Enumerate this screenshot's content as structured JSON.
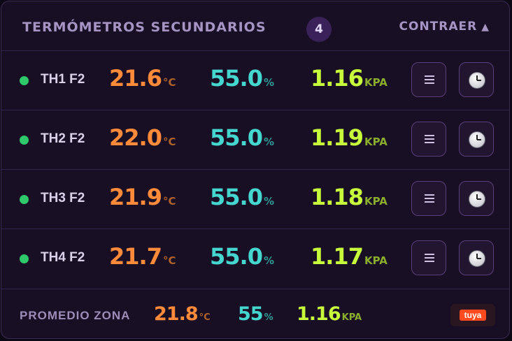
{
  "header": {
    "title": "TERMÓMETROS SECUNDARIOS",
    "count": "4",
    "collapse_label": "CONTRAER",
    "collapse_icon": "triangle-up-icon"
  },
  "units": {
    "temp": "°C",
    "hum": "%",
    "press": "KPA"
  },
  "sensors": [
    {
      "name": "TH1 F2",
      "temp": "21.6",
      "hum": "55.0",
      "press": "1.16",
      "status": "online"
    },
    {
      "name": "TH2 F2",
      "temp": "22.0",
      "hum": "55.0",
      "press": "1.19",
      "status": "online"
    },
    {
      "name": "TH3 F2",
      "temp": "21.9",
      "hum": "55.0",
      "press": "1.18",
      "status": "online"
    },
    {
      "name": "TH4 F2",
      "temp": "21.7",
      "hum": "55.0",
      "press": "1.17",
      "status": "online"
    }
  ],
  "buttons": {
    "menu_icon": "hamburger-menu-icon",
    "history_icon": "clock-icon"
  },
  "footer": {
    "label": "PROMEDIO ZONA",
    "temp": "21.8",
    "hum": "55",
    "press": "1.16",
    "brand": "tuya"
  },
  "colors": {
    "temp": "#ff8a3a",
    "hum": "#45d6d0",
    "press": "#c8fa3c",
    "status_online": "#2fc86a",
    "brand": "#ff4a1f"
  }
}
